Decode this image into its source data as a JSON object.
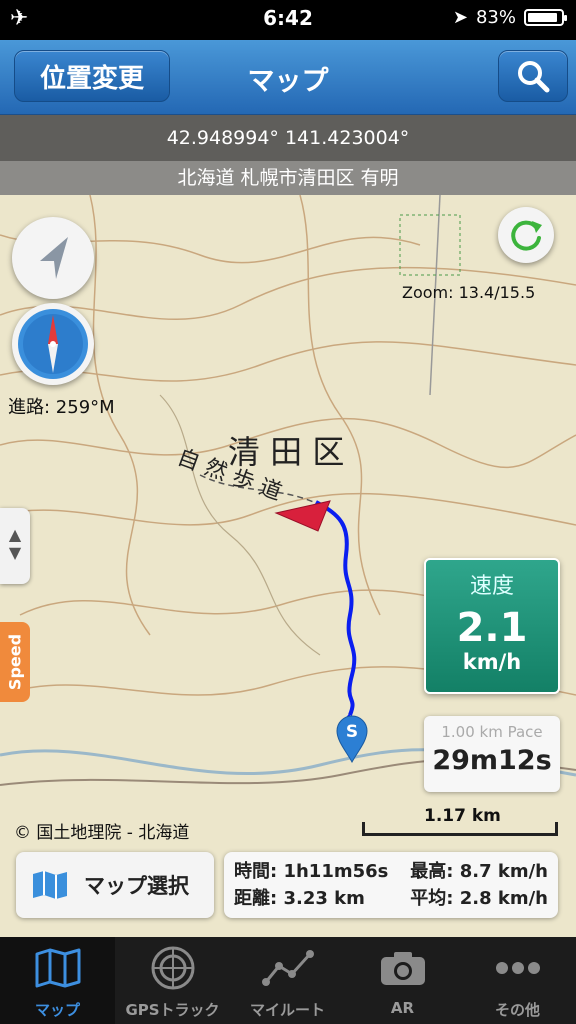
{
  "status_bar": {
    "time": "6:42",
    "battery": "83%"
  },
  "nav": {
    "left_button": "位置変更",
    "title": "マップ"
  },
  "coords": "42.948994° 141.423004°",
  "address": "北海道 札幌市清田区 有明",
  "map": {
    "zoom": "Zoom: 13.4/15.5",
    "heading": "進路: 259°M",
    "district_label": "清 田 区",
    "trail_label": "自 然 歩 道",
    "copyright": "© 国土地理院 - 北海道",
    "scale": "1.17 km",
    "side_tab": "Speed",
    "start_marker": "S"
  },
  "speed_panel": {
    "label": "速度",
    "value": "2.1",
    "unit": "km/h"
  },
  "pace_panel": {
    "label": "1.00 km Pace",
    "value": "29m12s"
  },
  "map_select": {
    "label": "マップ選択"
  },
  "stats": {
    "time": "時間: 1h11m56s",
    "max": "最高: 8.7 km/h",
    "distance": "距離: 3.23 km",
    "avg": "平均: 2.8 km/h"
  },
  "tabs": [
    {
      "label": "マップ",
      "icon": "map-icon",
      "active": true
    },
    {
      "label": "GPSトラック",
      "icon": "radar-icon",
      "active": false
    },
    {
      "label": "マイルート",
      "icon": "route-icon",
      "active": false
    },
    {
      "label": "AR",
      "icon": "camera-icon",
      "active": false
    },
    {
      "label": "その他",
      "icon": "more-icon",
      "active": false
    }
  ],
  "colors": {
    "nav_blue": "#2e78c4",
    "speed_green": "#1f8f74",
    "track_blue": "#0a1ef0",
    "heading_red": "#d8203c",
    "tab_active": "#3d8fe0"
  }
}
